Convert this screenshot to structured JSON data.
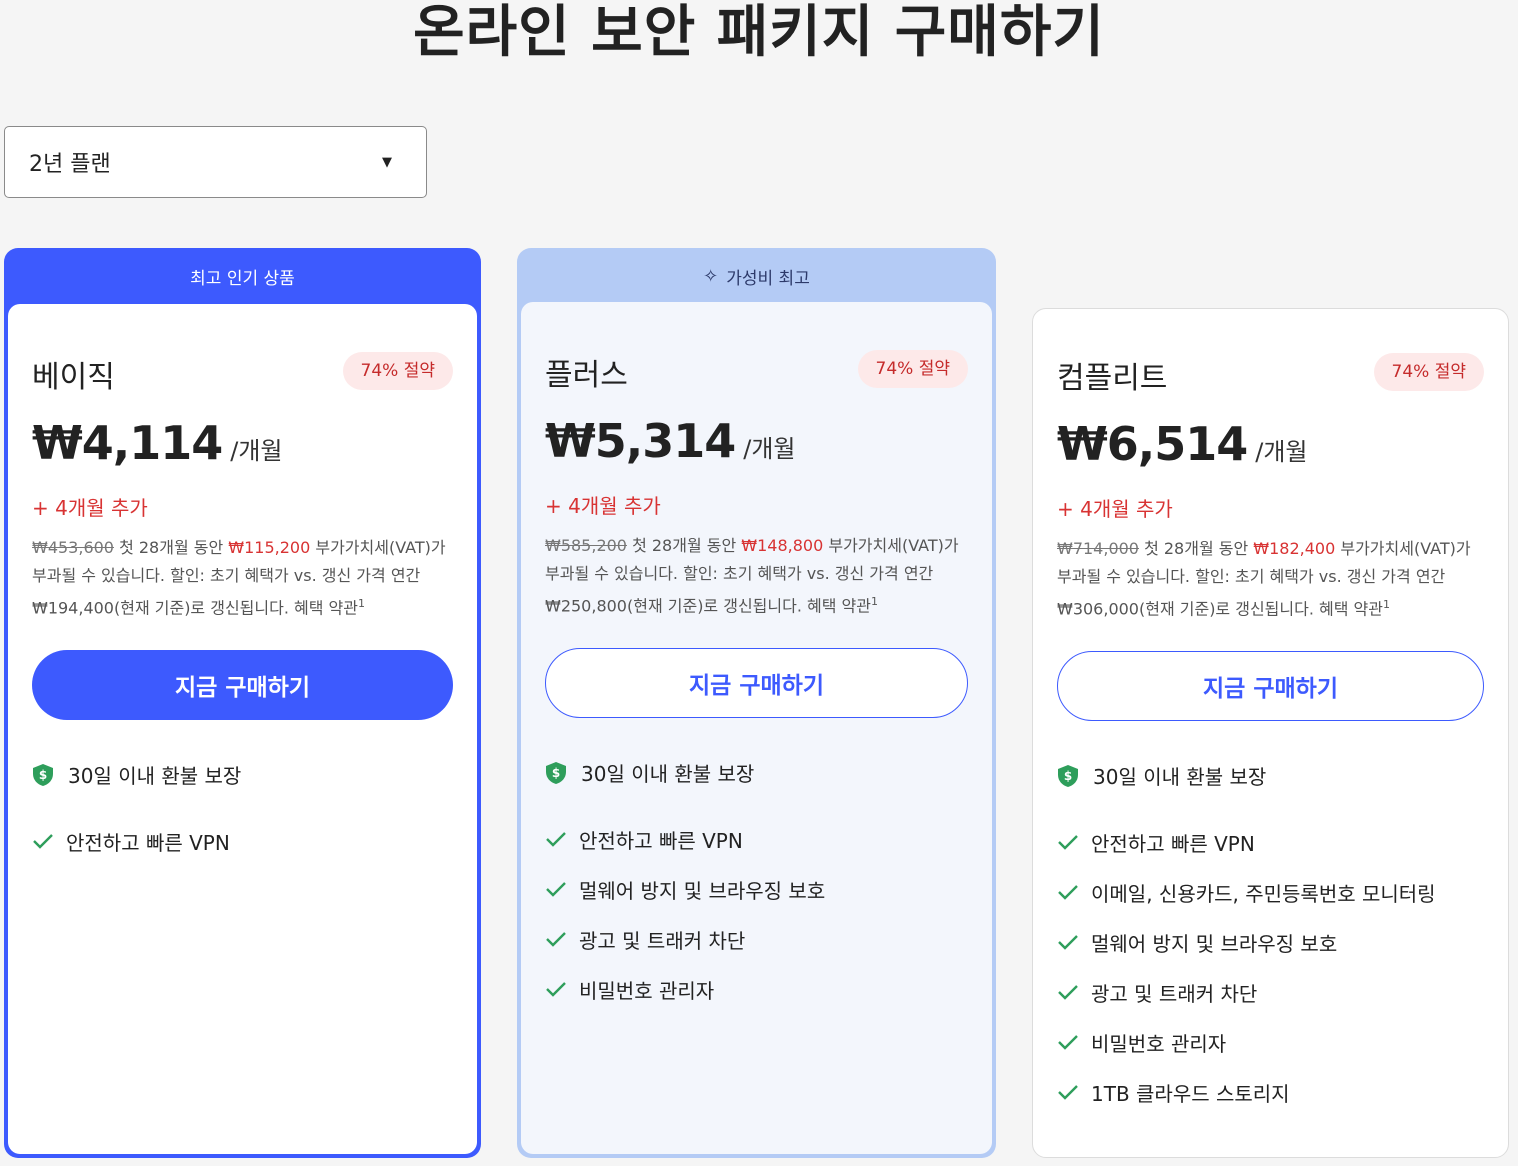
{
  "page": {
    "title": "온라인 보안 패키지 구매하기"
  },
  "plan_select": {
    "selected": "2년 플랜"
  },
  "colors": {
    "primary": "#3d5afe",
    "accent_red": "#d83333",
    "badge_bg": "#fde9e9",
    "green": "#2e9e5b",
    "plus_ribbon": "#b4cbf5"
  },
  "cards": [
    {
      "ribbon": "최고 인기 상품",
      "name": "베이직",
      "save_badge": "74% 절약",
      "price": "₩4,114",
      "per": "/개월",
      "bonus": "+ 4개월 추가",
      "original_price": "₩453,600",
      "fine_a": " 첫 28개월 동안 ",
      "promo_price": "₩115,200",
      "fine_b": " 부가가치세(VAT)가 부과될 수 있습니다. 할인: 초기 혜택가 vs. 갱신 가격 연간 ₩194,400(현재 기준)로 갱신됩니다. 혜택 약관",
      "footnote": "1",
      "button": "지금 구매하기",
      "guarantee": "30일 이내 환불 보장",
      "features": [
        "안전하고 빠른 VPN"
      ]
    },
    {
      "ribbon": "가성비 최고",
      "ribbon_icon": "sparkle-icon",
      "name": "플러스",
      "save_badge": "74% 절약",
      "price": "₩5,314",
      "per": "/개월",
      "bonus": "+ 4개월 추가",
      "original_price": "₩585,200",
      "fine_a": " 첫 28개월 동안 ",
      "promo_price": "₩148,800",
      "fine_b": " 부가가치세(VAT)가 부과될 수 있습니다. 할인: 초기 혜택가 vs. 갱신 가격 연간 ₩250,800(현재 기준)로 갱신됩니다. 혜택 약관",
      "footnote": "1",
      "button": "지금 구매하기",
      "guarantee": "30일 이내 환불 보장",
      "features": [
        "안전하고 빠른 VPN",
        "멀웨어 방지 및 브라우징 보호",
        "광고 및 트래커 차단",
        "비밀번호 관리자"
      ]
    },
    {
      "name": "컴플리트",
      "save_badge": "74% 절약",
      "price": "₩6,514",
      "per": "/개월",
      "bonus": "+ 4개월 추가",
      "original_price": "₩714,000",
      "fine_a": " 첫 28개월 동안 ",
      "promo_price": "₩182,400",
      "fine_b": " 부가가치세(VAT)가 부과될 수 있습니다. 할인: 초기 혜택가 vs. 갱신 가격 연간 ₩306,000(현재 기준)로 갱신됩니다. 혜택 약관",
      "footnote": "1",
      "button": "지금 구매하기",
      "guarantee": "30일 이내 환불 보장",
      "features": [
        "안전하고 빠른 VPN",
        "이메일, 신용카드, 주민등록번호 모니터링",
        "멀웨어 방지 및 브라우징 보호",
        "광고 및 트래커 차단",
        "비밀번호 관리자",
        "1TB 클라우드 스토리지"
      ]
    }
  ]
}
